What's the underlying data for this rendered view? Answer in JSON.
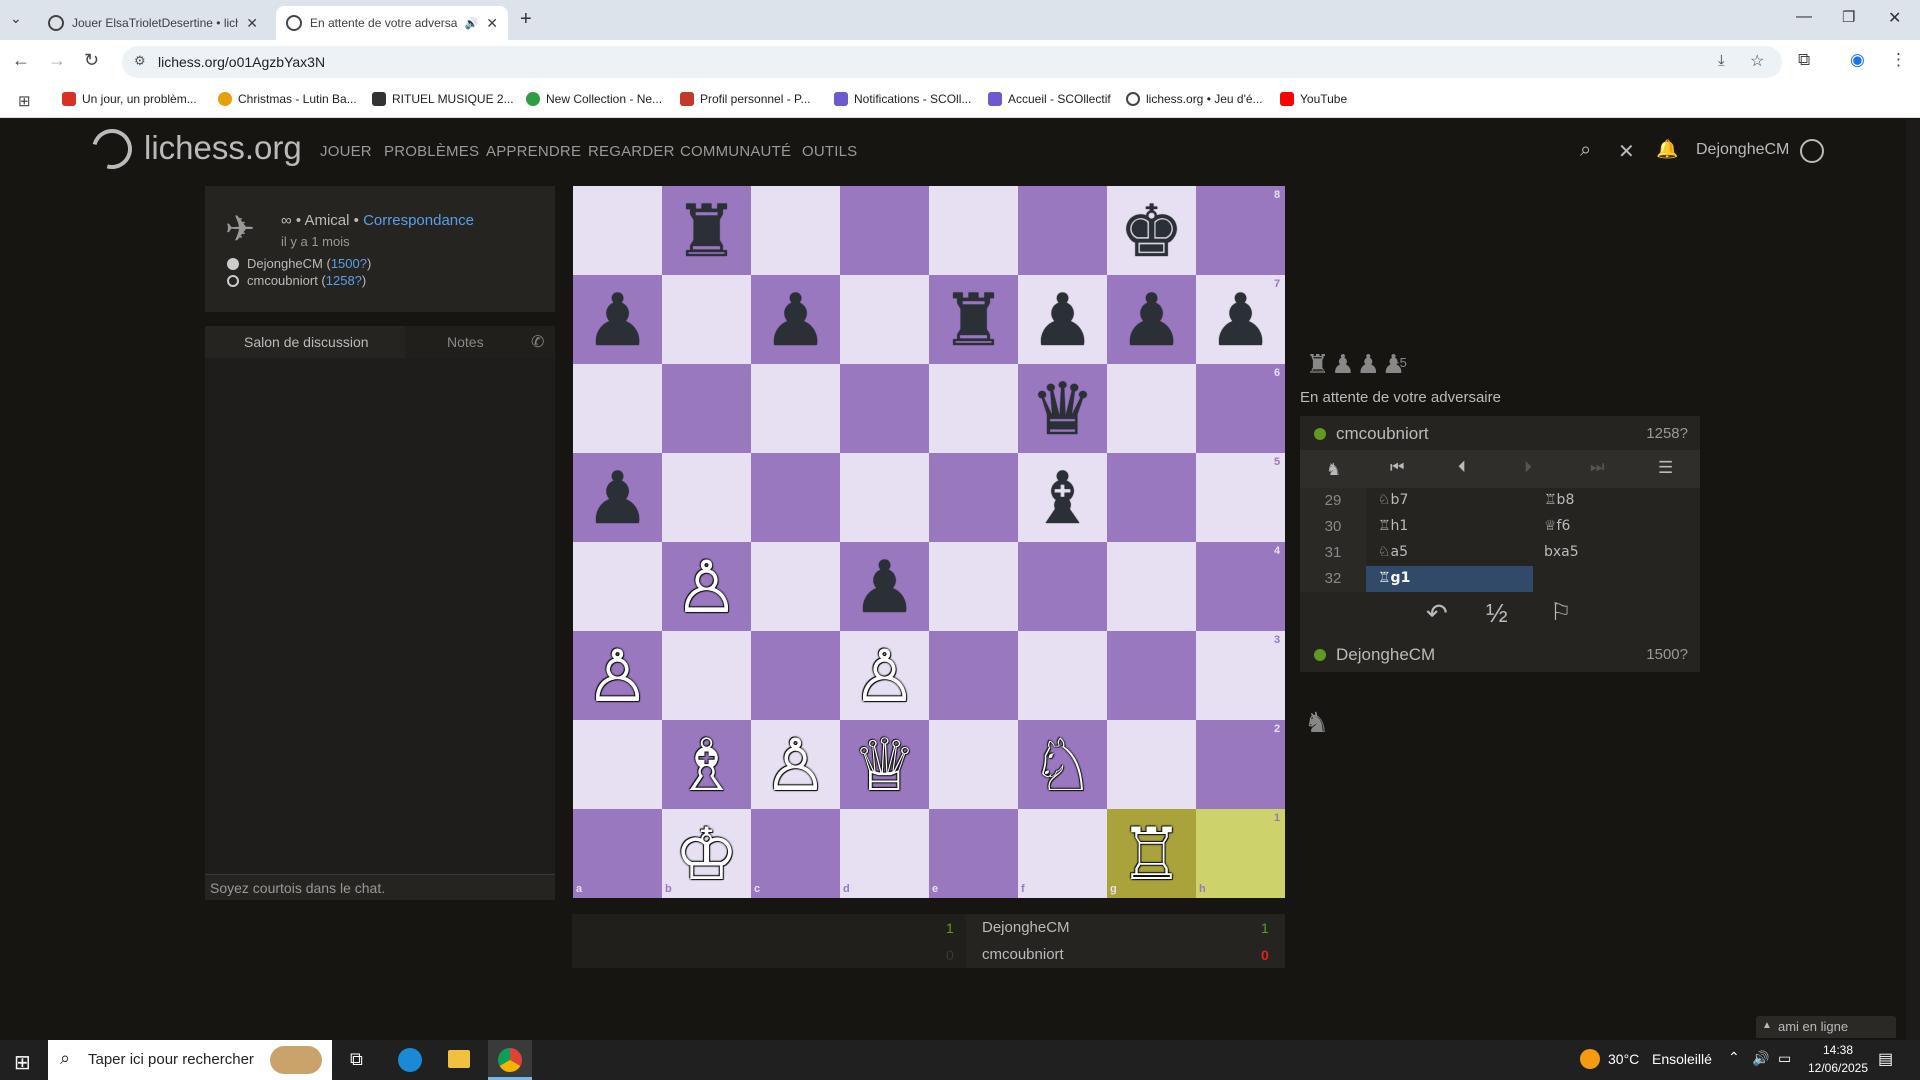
{
  "browser": {
    "tabs": [
      {
        "title": "Jouer ElsaTrioletDesertine • lich"
      },
      {
        "title": "En attente de votre adversa"
      }
    ],
    "url": "lichess.org/o01AgzbYax3N",
    "bookmarks": [
      "Un jour, un problèm...",
      "Christmas - Lutin Ba...",
      "RITUEL MUSIQUE 2...",
      "New Collection - Ne...",
      "Profil personnel - P...",
      "Notifications - SCOll...",
      "Accueil - SCOllectif",
      "lichess.org • Jeu d'é...",
      "YouTube"
    ]
  },
  "site": {
    "logo": "lichess.org",
    "nav": [
      "JOUER",
      "PROBLÈMES",
      "APPRENDRE",
      "REGARDER",
      "COMMUNAUTÉ",
      "OUTILS"
    ],
    "username": "DejongheCM"
  },
  "game_info": {
    "mode": "∞ • Amical •",
    "variant": "Correspondance",
    "when": "il y a 1 mois",
    "white_name": "DejongheCM",
    "white_rating": "1500?",
    "black_name": "cmcoubniort",
    "black_rating": "1258?"
  },
  "chat": {
    "tab_discussion": "Salon de discussion",
    "tab_notes": "Notes",
    "placeholder": "Soyez courtois dans le chat."
  },
  "board": {
    "files": [
      "a",
      "b",
      "c",
      "d",
      "e",
      "f",
      "g",
      "h"
    ],
    "ranks": [
      "8",
      "7",
      "6",
      "5",
      "4",
      "3",
      "2",
      "1"
    ],
    "highlight": [
      "g1",
      "h1"
    ],
    "pieces": [
      {
        "sq": "b8",
        "p": "♜",
        "c": "b"
      },
      {
        "sq": "g8",
        "p": "♚",
        "c": "b"
      },
      {
        "sq": "a7",
        "p": "♟",
        "c": "b"
      },
      {
        "sq": "c7",
        "p": "♟",
        "c": "b"
      },
      {
        "sq": "e7",
        "p": "♜",
        "c": "b"
      },
      {
        "sq": "f7",
        "p": "♟",
        "c": "b"
      },
      {
        "sq": "g7",
        "p": "♟",
        "c": "b"
      },
      {
        "sq": "h7",
        "p": "♟",
        "c": "b"
      },
      {
        "sq": "f6",
        "p": "♛",
        "c": "b"
      },
      {
        "sq": "a5",
        "p": "♟",
        "c": "b"
      },
      {
        "sq": "f5",
        "p": "♝",
        "c": "b"
      },
      {
        "sq": "b4",
        "p": "♙",
        "c": "w"
      },
      {
        "sq": "d4",
        "p": "♟",
        "c": "b"
      },
      {
        "sq": "a3",
        "p": "♙",
        "c": "w"
      },
      {
        "sq": "d3",
        "p": "♙",
        "c": "w"
      },
      {
        "sq": "b2",
        "p": "♗",
        "c": "w"
      },
      {
        "sq": "c2",
        "p": "♙",
        "c": "w"
      },
      {
        "sq": "d2",
        "p": "♕",
        "c": "w"
      },
      {
        "sq": "f2",
        "p": "♘",
        "c": "w"
      },
      {
        "sq": "b1",
        "p": "♔",
        "c": "w"
      },
      {
        "sq": "g1",
        "p": "♖",
        "c": "w"
      }
    ]
  },
  "captured": {
    "pieces": "♜♟♟♟",
    "diff": "+5",
    "own": "♞"
  },
  "status": "En attente de votre adversaire",
  "top_player": {
    "name": "cmcoubniort",
    "rating": "1258?"
  },
  "bottom_player": {
    "name": "DejongheCM",
    "rating": "1500?"
  },
  "moves": [
    {
      "n": "29",
      "w": "♘b7",
      "b": "♖b8"
    },
    {
      "n": "30",
      "w": "♖h1",
      "b": "♕f6"
    },
    {
      "n": "31",
      "w": "♘a5",
      "b": "bxa5"
    },
    {
      "n": "32",
      "w": "♖g1",
      "b": ""
    }
  ],
  "score": {
    "p1_name": "DejongheCM",
    "p1_left": "1",
    "p1_right": "1",
    "p2_name": "cmcoubniort",
    "p2_left": "0",
    "p2_right": "0"
  },
  "friends": "ami en ligne",
  "taskbar": {
    "search": "Taper ici pour rechercher",
    "weather_temp": "30°C",
    "weather_text": "Ensoleillé",
    "time": "14:38",
    "date": "12/06/2025"
  },
  "colors": {
    "accent": "#5b9ee8",
    "online": "#629924",
    "board_light": "#e7dff2",
    "board_dark": "#9a78c0"
  }
}
